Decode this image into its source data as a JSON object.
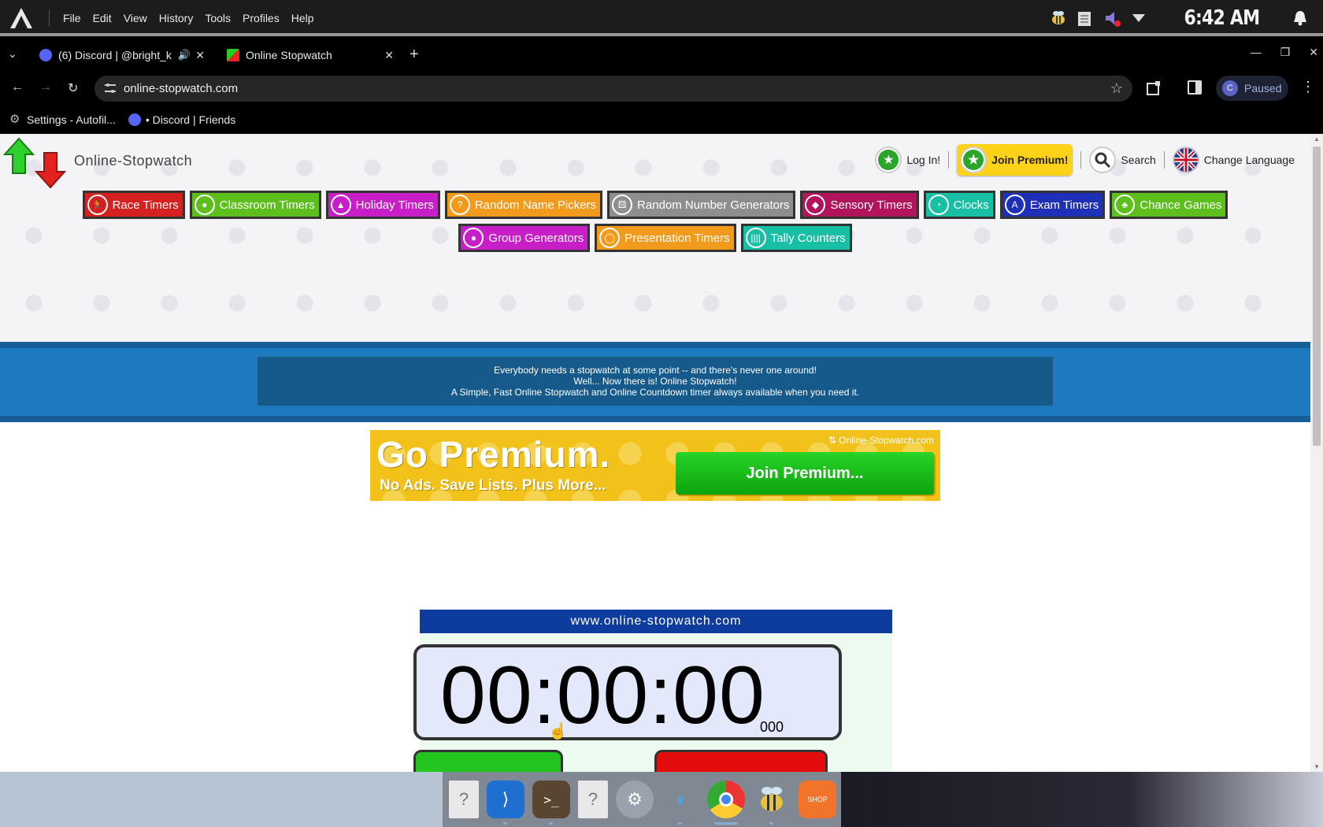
{
  "system": {
    "menu": [
      "File",
      "Edit",
      "View",
      "History",
      "Tools",
      "Profiles",
      "Help"
    ],
    "clock": "6:42 AM"
  },
  "tabs": [
    {
      "title": "(6) Discord | @bright_k"
    },
    {
      "title": "Online Stopwatch"
    }
  ],
  "address": {
    "url": "online-stopwatch.com",
    "profile_status": "Paused",
    "profile_initial": "C"
  },
  "bookmarks": [
    {
      "label": "Settings - Autofil..."
    },
    {
      "label": "• Discord | Friends"
    }
  ],
  "site": {
    "name": "Online-Stopwatch",
    "header_links": {
      "login": "Log In!",
      "premium": "Join Premium!",
      "search": "Search",
      "language": "Change Language"
    },
    "categories_row1": [
      {
        "label": "Race Timers",
        "color": "#d4201e"
      },
      {
        "label": "Classroom Timers",
        "color": "#5cbf1c"
      },
      {
        "label": "Holiday Timers",
        "color": "#c81ec8"
      },
      {
        "label": "Random Name Pickers",
        "color": "#f29a1c"
      },
      {
        "label": "Random Number Generators",
        "color": "#8e8e8e"
      },
      {
        "label": "Sensory Timers",
        "color": "#b2145c"
      },
      {
        "label": "Clocks",
        "color": "#17bfa5"
      },
      {
        "label": "Exam Timers",
        "color": "#1e2fb8"
      },
      {
        "label": "Chance Games",
        "color": "#5cbf1c"
      }
    ],
    "categories_row2": [
      {
        "label": "Group Generators",
        "color": "#c81ec8"
      },
      {
        "label": "Presentation Timers",
        "color": "#f29a1c"
      },
      {
        "label": "Tally Counters",
        "color": "#17bfa5"
      }
    ],
    "intro": {
      "line1": "Everybody needs a stopwatch at some point -- and there's never one around!",
      "line2": "Well... Now there is! Online Stopwatch!",
      "line3": "A Simple, Fast Online Stopwatch and Online Countdown timer always available when you need it."
    },
    "premium_banner": {
      "title": "Go Premium.",
      "subtitle": "No Ads. Save Lists. Plus More...",
      "brand": "Online-Stopwatch.com",
      "button": "Join Premium..."
    },
    "stopwatch": {
      "url_label": "www.online-stopwatch.com",
      "time": "00:00:00",
      "ms": "000"
    }
  },
  "dock": [
    "unknown-app",
    "vscode",
    "terminal",
    "unknown-app",
    "settings",
    "dolphin",
    "chrome",
    "bee",
    "shop"
  ]
}
